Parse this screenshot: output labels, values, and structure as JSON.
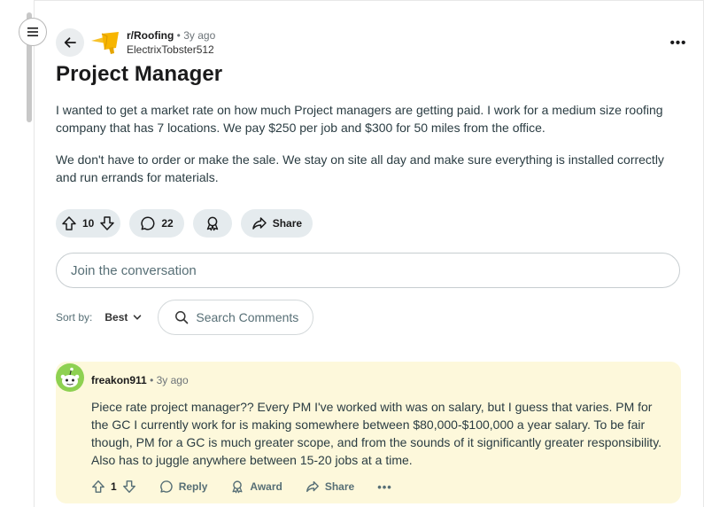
{
  "post": {
    "subreddit": "r/Roofing",
    "separator": "•",
    "age": "3y ago",
    "author": "ElectrixTobster512",
    "more_label": "•••",
    "title": "Project Manager",
    "body": [
      "I wanted to get a market rate on how much Project managers are getting paid. I work for a medium size roofing company that has 7 locations. We pay $250 per job and $300 for 50 miles from the office.",
      "We don't have to order or make the sale. We stay on site all day and make sure everything is installed correctly and run errands for materials."
    ],
    "votes": "10",
    "comments": "22",
    "share_label": "Share"
  },
  "composer": {
    "placeholder": "Join the conversation"
  },
  "sort": {
    "label": "Sort by:",
    "value": "Best",
    "search_placeholder": "Search Comments"
  },
  "comment": {
    "author": "freakon911",
    "separator": "•",
    "age": "3y ago",
    "body": "Piece rate project manager?? Every PM I've worked with was on salary, but I guess that varies. PM for the GC I currently work for is making somewhere between $80,000-$100,000 a year salary. To be fair though, PM for a GC is much greater scope, and from the sounds of it significantly greater responsibility. Also has to juggle anywhere between 15-20 jobs at a time.",
    "votes": "1",
    "reply_label": "Reply",
    "award_label": "Award",
    "share_label": "Share",
    "more_label": "•••",
    "highlight_color": "#fdf8db"
  },
  "icons": [
    "menu-icon",
    "back-arrow-icon",
    "subreddit-avatar",
    "more-icon",
    "upvote-icon",
    "downvote-icon",
    "comment-icon",
    "award-icon",
    "share-icon",
    "search-icon",
    "chevron-down-icon",
    "snoo-avatar"
  ]
}
